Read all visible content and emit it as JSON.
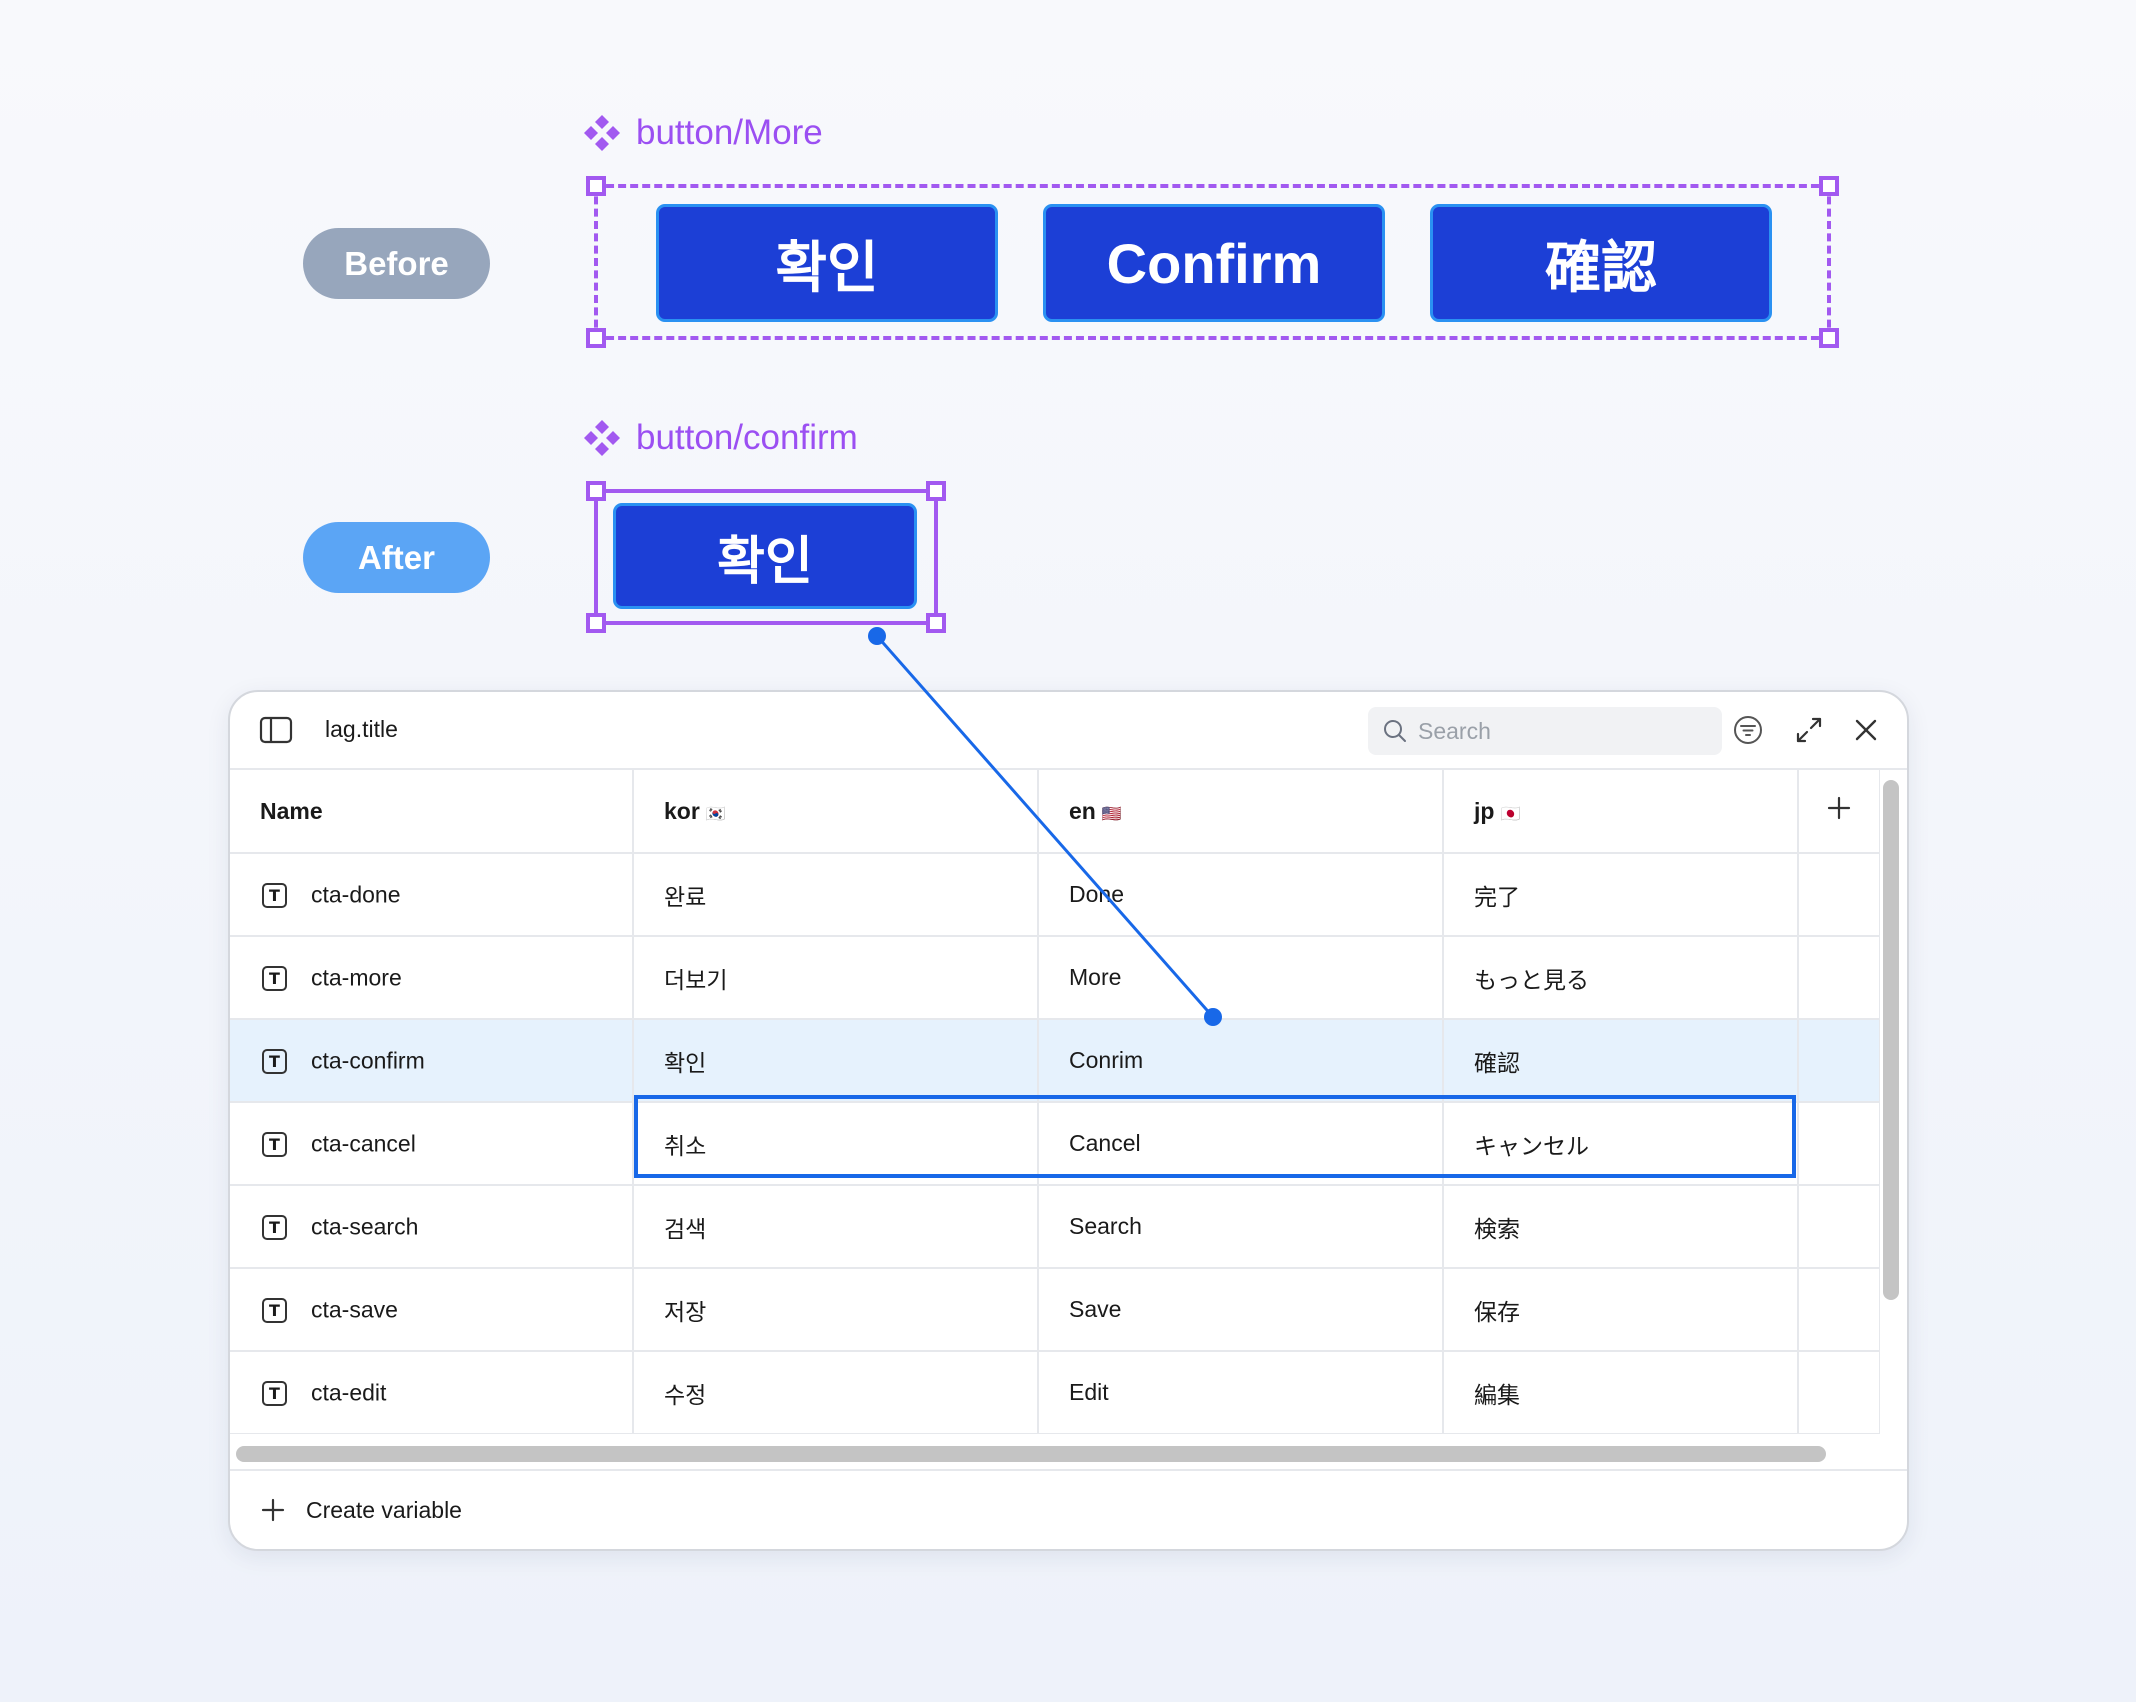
{
  "labels": {
    "before": "Before",
    "after": "After"
  },
  "components": {
    "more": {
      "name": "button/More",
      "buttons": [
        "확인",
        "Confirm",
        "確認"
      ]
    },
    "confirm": {
      "name": "button/confirm",
      "button": "확인"
    }
  },
  "panel": {
    "title": "lag.title",
    "search_placeholder": "Search",
    "columns": [
      {
        "label": "Name",
        "flag": ""
      },
      {
        "label": "kor",
        "flag": "🇰🇷"
      },
      {
        "label": "en",
        "flag": "🇺🇸"
      },
      {
        "label": "jp",
        "flag": "🇯🇵"
      }
    ],
    "add_column": "+",
    "rows": [
      {
        "name": "cta-done",
        "kor": "완료",
        "en": "Done",
        "jp": "完了"
      },
      {
        "name": "cta-more",
        "kor": "더보기",
        "en": "More",
        "jp": "もっと見る"
      },
      {
        "name": "cta-confirm",
        "kor": "확인",
        "en": "Conrim",
        "jp": "確認"
      },
      {
        "name": "cta-cancel",
        "kor": "취소",
        "en": "Cancel",
        "jp": "キャンセル"
      },
      {
        "name": "cta-search",
        "kor": "검색",
        "en": "Search",
        "jp": "検索"
      },
      {
        "name": "cta-save",
        "kor": "저장",
        "en": "Save",
        "jp": "保存"
      },
      {
        "name": "cta-edit",
        "kor": "수정",
        "en": "Edit",
        "jp": "編集"
      }
    ],
    "selected_row": "cta-confirm",
    "text_type_icon": "T",
    "footer": {
      "create_label": "Create variable"
    }
  },
  "colors": {
    "accent_purple": "#a259f0",
    "button_blue": "#1c3fd6",
    "selection_blue": "#1868e8",
    "before_pill": "#97a6bc",
    "after_pill": "#5ba5f5"
  },
  "icons": [
    "component-icon",
    "sidebar-toggle-icon",
    "search-icon",
    "filter-icon",
    "expand-icon",
    "close-icon",
    "text-type-icon",
    "plus-icon"
  ]
}
